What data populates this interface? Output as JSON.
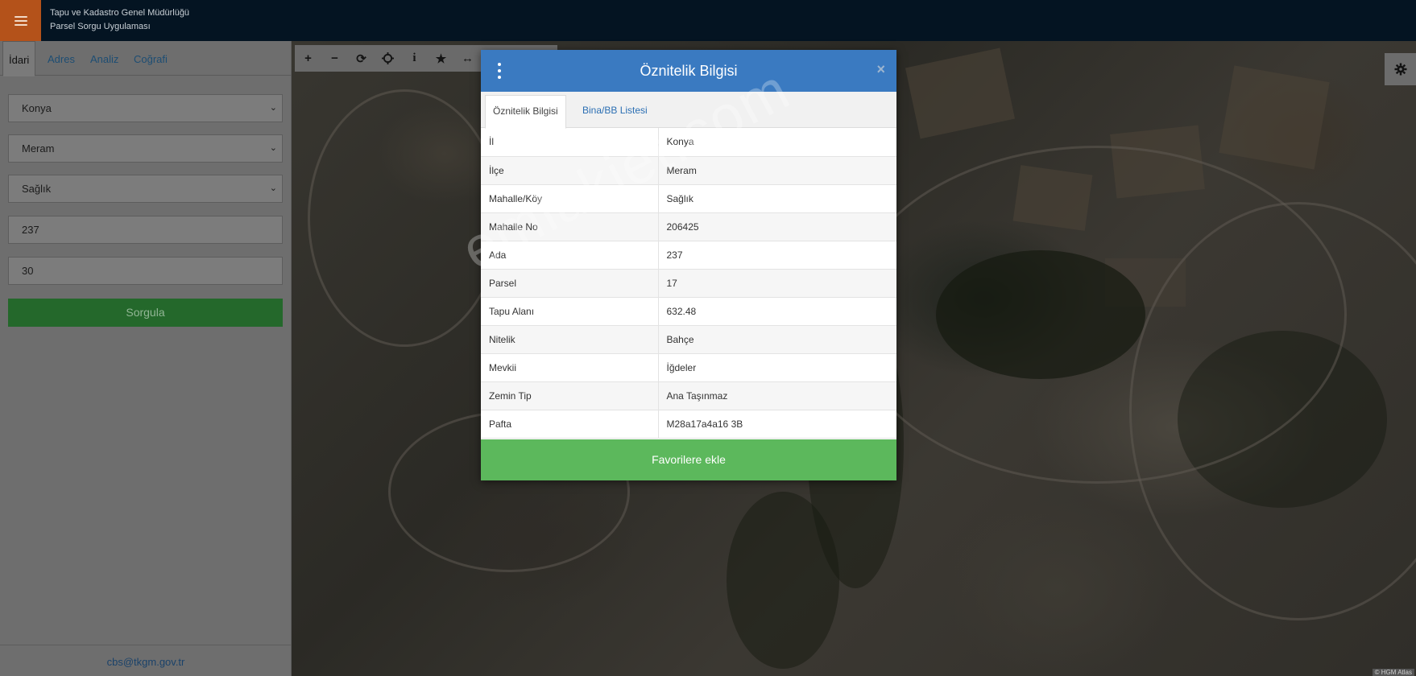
{
  "header": {
    "title_line1": "Tapu ve Kadastro Genel Müdürlüğü",
    "title_line2": "Parsel Sorgu Uygulaması"
  },
  "sidebar": {
    "tabs": [
      {
        "label": "İdari",
        "active": true
      },
      {
        "label": "Adres",
        "active": false
      },
      {
        "label": "Analiz",
        "active": false
      },
      {
        "label": "Coğrafi",
        "active": false
      }
    ],
    "fields": {
      "province": "Konya",
      "district": "Meram",
      "neighborhood": "Sağlık",
      "ada": "237",
      "parsel": "30"
    },
    "query_label": "Sorgula",
    "footer_email": "cbs@tkgm.gov.tr"
  },
  "map": {
    "attribution": "© HGM Atlas"
  },
  "modal": {
    "title": "Öznitelik Bilgisi",
    "close_glyph": "×",
    "tabs": [
      {
        "label": "Öznitelik Bilgisi",
        "active": true
      },
      {
        "label": "Bina/BB Listesi",
        "active": false
      }
    ],
    "rows": [
      {
        "key": "İl",
        "value": "Konya"
      },
      {
        "key": "İlçe",
        "value": "Meram"
      },
      {
        "key": "Mahalle/Köy",
        "value": "Sağlık"
      },
      {
        "key": "Mahalle No",
        "value": "206425"
      },
      {
        "key": "Ada",
        "value": "237"
      },
      {
        "key": "Parsel",
        "value": "17"
      },
      {
        "key": "Tapu Alanı",
        "value": "632.48"
      },
      {
        "key": "Nitelik",
        "value": "Bahçe"
      },
      {
        "key": "Mevkii",
        "value": "İğdeler"
      },
      {
        "key": "Zemin Tip",
        "value": "Ana Taşınmaz"
      },
      {
        "key": "Pafta",
        "value": "M28a17a4a16 3B"
      }
    ],
    "favorite_label": "Favorilere ekle"
  },
  "watermark": "emlakjet.com",
  "colors": {
    "topbar": "#041422",
    "menu_accent": "#b4521a",
    "modal_header": "#3a7ac1",
    "favorite_button": "#5cb85c",
    "query_button": "#24682b"
  }
}
